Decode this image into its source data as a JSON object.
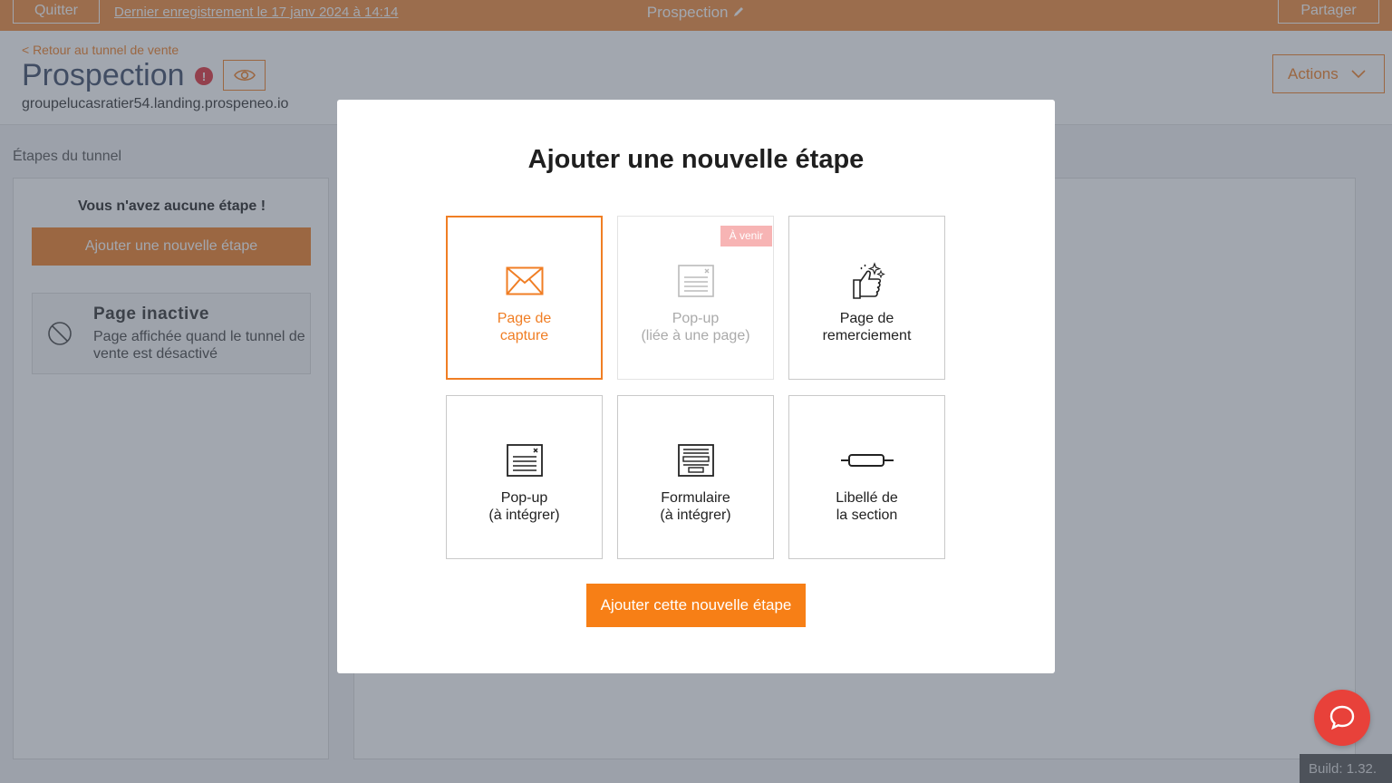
{
  "topbar": {
    "quit_label": "Quitter",
    "last_saved": "Dernier enregistrement le 17 janv 2024 à 14:14",
    "title": "Prospection",
    "share_label": "Partager"
  },
  "header": {
    "back_link": "< Retour au tunnel de vente",
    "title": "Prospection",
    "warning_badge": "!",
    "domain": "groupelucasratier54.landing.prospeneo.io",
    "actions_label": "Actions"
  },
  "sidebar": {
    "section_label": "Étapes du tunnel",
    "empty_message": "Vous n'avez aucune étape !",
    "add_step_label": "Ajouter une nouvelle étape",
    "inactive_title": "Page inactive",
    "inactive_desc": "Page affichée quand le tunnel de vente est désactivé"
  },
  "modal": {
    "title": "Ajouter une nouvelle étape",
    "options": [
      {
        "line1": "Page de",
        "line2": "capture",
        "icon": "envelope-icon",
        "state": "selected"
      },
      {
        "line1": "Pop-up",
        "line2": "(liée à une page)",
        "icon": "popup-page-icon",
        "state": "disabled",
        "badge": "À venir"
      },
      {
        "line1": "Page de",
        "line2": "remerciement",
        "icon": "thumbs-up-icon",
        "state": "normal"
      },
      {
        "line1": "Pop-up",
        "line2": "(à intégrer)",
        "icon": "popup-embed-icon",
        "state": "normal"
      },
      {
        "line1": "Formulaire",
        "line2": "(à intégrer)",
        "icon": "form-icon",
        "state": "normal"
      },
      {
        "line1": "Libellé de",
        "line2": "la section",
        "icon": "section-label-icon",
        "state": "normal"
      }
    ],
    "cta_label": "Ajouter cette nouvelle étape"
  },
  "build_label": "Build: 1.32.",
  "colors": {
    "accent": "#f07e24",
    "cta": "#f77f16",
    "help": "#e8413a",
    "warning": "#e0313a"
  }
}
